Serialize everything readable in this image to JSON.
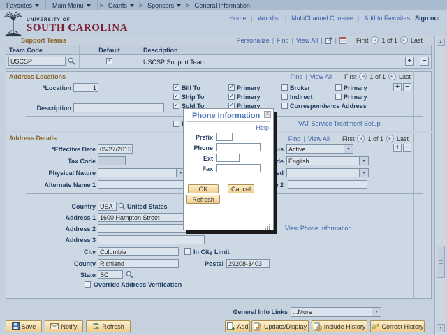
{
  "ui": {
    "sep": "|",
    "crumb_sep": ">"
  },
  "colors": {
    "garnet": "#7b2034",
    "link_blue": "#3c5ea9",
    "section_brown": "#8a6428",
    "button_face": "#f1cd8e",
    "page_bg": "#c5d1dd"
  },
  "breadcrumb": {
    "items": [
      "Favorites",
      "Main Menu",
      "Grants",
      "Sponsors",
      "General Information"
    ]
  },
  "header": {
    "logo_line1": "UNIVERSITY OF",
    "logo_line2": "SOUTH CAROLINA",
    "links": [
      "Home",
      "Worklist",
      "MultiChannel Console",
      "Add to Favorites"
    ],
    "signout": "Sign out"
  },
  "support": {
    "title": "Support Teams",
    "personalize": "Personalize",
    "find": "Find",
    "view_all": "View All",
    "first": "First",
    "count": "1 of 1",
    "last": "Last",
    "col_team_code": "Team Code",
    "col_default": "Default",
    "col_description": "Description",
    "team_code": "USCSP",
    "default_checked": true,
    "description": "USCSP Support Team"
  },
  "loc": {
    "title": "Address Locations",
    "find": "Find",
    "view_all": "View All",
    "first": "First",
    "count": "1 of 1",
    "last": "Last",
    "location_label": "*Location",
    "location_value": "1",
    "desc_label": "Description",
    "desc_value": "",
    "checkboxes": [
      {
        "label": "Bill To",
        "checked": true
      },
      {
        "label": "Primary",
        "checked": true
      },
      {
        "label": "Broker",
        "checked": false
      },
      {
        "label": "Primary",
        "checked": false
      },
      {
        "label": "Ship To",
        "checked": true
      },
      {
        "label": "Primary",
        "checked": true
      },
      {
        "label": "Indirect",
        "checked": false
      },
      {
        "label": "Primary",
        "checked": false
      },
      {
        "label": "Sold To",
        "checked": true
      },
      {
        "label": "Primary",
        "checked": true
      },
      {
        "label": "Correspondence Address",
        "checked": false
      },
      {
        "label": "Remit To",
        "checked": false
      }
    ],
    "vat_link": "VAT Service Treatment Setup"
  },
  "det": {
    "title": "Address Details",
    "find": "Find",
    "view_all": "View All",
    "first": "First",
    "count": "1 of 1",
    "last": "Last",
    "eff_label": "*Effective Date",
    "eff_value": "05/27/2015",
    "status_label": "*Status",
    "status_value": "Active",
    "tax_label": "Tax Code",
    "tax_value": "",
    "lang_label": "Language Code",
    "lang_value": "English",
    "phys_label": "Physical Nature",
    "phys_value": "",
    "where_label": "Where Performed",
    "where_value": "",
    "alt1_label": "Alternate Name 1",
    "alt1_value": "",
    "alt2_label": "Alternate Name 2",
    "alt2_value": "",
    "country_label": "Country",
    "country_value": "USA",
    "country_name": "United States",
    "addr1_label": "Address 1",
    "addr1_value": "1600 Hampton Street",
    "addr2_label": "Address 2",
    "addr2_value": "",
    "addr3_label": "Address 3",
    "addr3_value": "",
    "view_phone_link": "View Phone Information",
    "city_label": "City",
    "city_value": "Columbia",
    "in_city_label": "In City Limit",
    "in_city_checked": false,
    "county_label": "County",
    "county_value": "Richland",
    "postal_label": "Postal",
    "postal_value": "29208-3403",
    "state_label": "State",
    "state_value": "SC",
    "override_label": "Override Address Verification",
    "override_checked": false
  },
  "footer": {
    "links_label": "General Info Links",
    "links_value": "...More"
  },
  "toolbar": {
    "save": "Save",
    "notify": "Notify",
    "refresh": "Refresh",
    "add": "Add",
    "update": "Update/Display",
    "include": "Include History",
    "correct": "Correct History"
  },
  "modal": {
    "title": "Phone Information",
    "close": "x",
    "help": "Help",
    "prefix_label": "Prefix",
    "prefix_value": "",
    "phone_label": "Phone",
    "phone_value": "",
    "ext_label": "Ext",
    "ext_value": "",
    "fax_label": "Fax",
    "fax_value": "",
    "ok": "OK",
    "cancel": "Cancel",
    "refresh": "Refresh"
  }
}
